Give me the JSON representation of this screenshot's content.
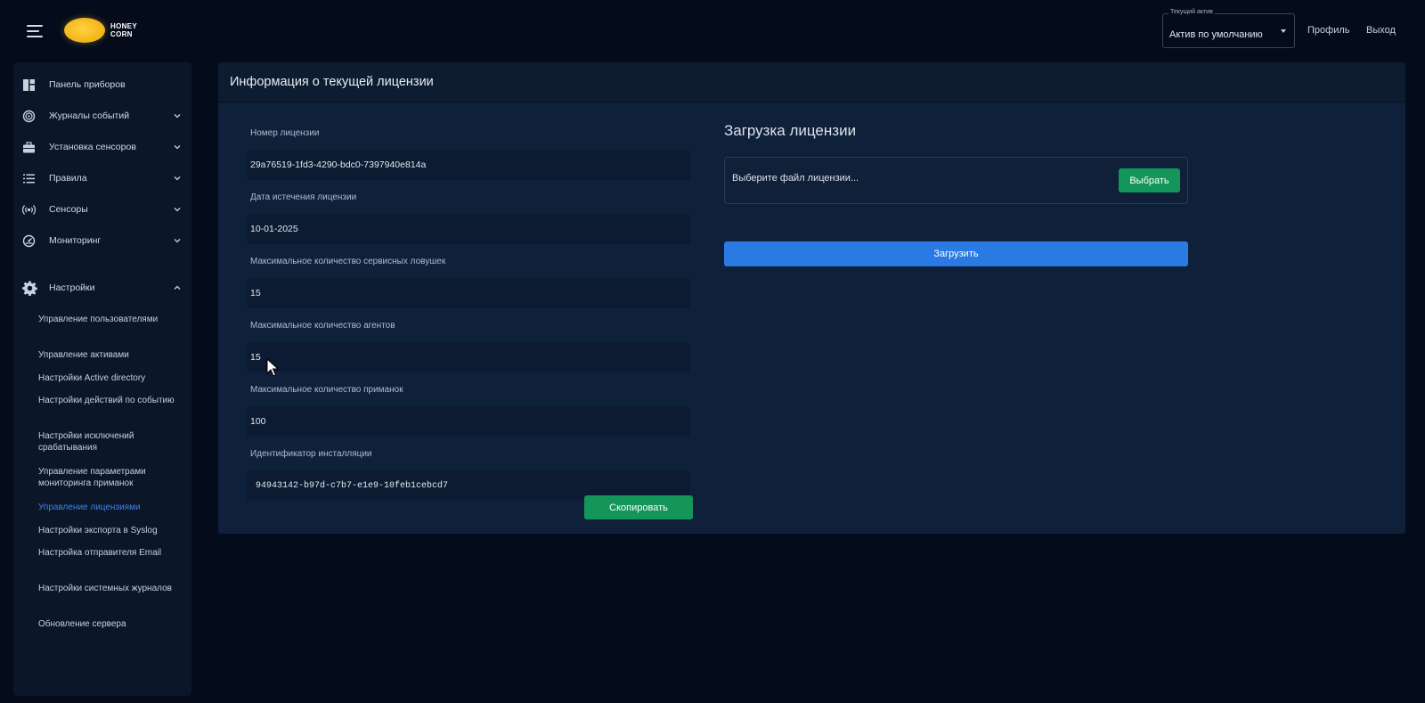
{
  "topbar": {
    "logo_line1": "HONEY",
    "logo_line2": "CORN",
    "asset_select": {
      "legend": "Текущий актив",
      "value": "Актив по умолчанию"
    },
    "profile_link": "Профиль",
    "exit_link": "Выход"
  },
  "sidebar": {
    "items": [
      {
        "label": "Панель приборов",
        "icon": "dashboard-icon"
      },
      {
        "label": "Журналы событий",
        "icon": "journal-icon"
      },
      {
        "label": "Установка сенсоров",
        "icon": "toolbox-icon"
      },
      {
        "label": "Правила",
        "icon": "list-icon"
      },
      {
        "label": "Сенсоры",
        "icon": "broadcast-icon"
      },
      {
        "label": "Мониторинг",
        "icon": "gauge-icon"
      },
      {
        "label": "Настройки",
        "icon": "gear-icon"
      }
    ],
    "settings_subitems": [
      "Управление пользователями",
      "Управление активами",
      "Настройки Active directory",
      "Настройки действий по событию",
      "Настройки исключений срабатывания",
      "Управление параметрами мониторинга приманок",
      "Управление лицензиями",
      "Настройки экспорта в Syslog",
      "Настройка отправителя Email",
      "Настройки системных журналов",
      "Обновление сервера"
    ]
  },
  "license": {
    "title": "Информация о текущей лицензии",
    "fields": [
      {
        "label": "Номер лицензии",
        "value": "29a76519-1fd3-4290-bdc0-7397940e814a"
      },
      {
        "label": "Дата истечения лицензии",
        "value": "10-01-2025"
      },
      {
        "label": "Максимальное количество сервисных ловушек",
        "value": "15"
      },
      {
        "label": "Максимальное количество агентов",
        "value": "15"
      },
      {
        "label": "Максимальное количество приманок",
        "value": "100"
      },
      {
        "label": "Идентификатор инсталляции",
        "value": "94943142-b97d-c7b7-e1e9-10feb1cebcd7"
      }
    ],
    "copy_button": "Скопировать"
  },
  "upload": {
    "title": "Загрузка лицензии",
    "file_placeholder": "Выберите файл лицензии...",
    "choose_button": "Выбрать",
    "upload_button": "Загрузить"
  },
  "colors": {
    "background": "#040c1b",
    "sidebar": "#0b1729",
    "card_body": "#0f213a",
    "green_button": "#14965a",
    "blue_button": "#2a7ae4",
    "active_link": "#3f82ea"
  }
}
